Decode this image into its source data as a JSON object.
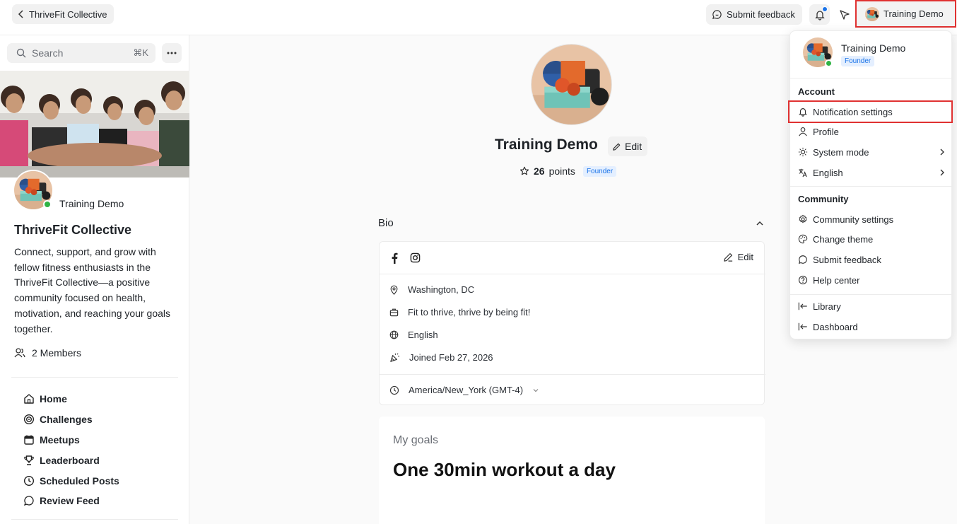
{
  "topbar": {
    "back_label": "ThriveFit Collective",
    "feedback_label": "Submit feedback",
    "user_label": "Training Demo"
  },
  "sidebar": {
    "search_placeholder": "Search",
    "search_shortcut": "⌘K",
    "username": "Training Demo",
    "community_title": "ThriveFit Collective",
    "description": "Connect, support, and grow with fellow fitness enthusiasts in the ThriveFit Collective—a positive community focused on health, motivation, and reaching your goals together.",
    "members": "2 Members",
    "nav": [
      {
        "label": "Home",
        "icon": "home-icon"
      },
      {
        "label": "Challenges",
        "icon": "target-icon"
      },
      {
        "label": "Meetups",
        "icon": "calendar-icon"
      },
      {
        "label": "Leaderboard",
        "icon": "trophy-icon"
      },
      {
        "label": "Scheduled Posts",
        "icon": "clock-icon"
      },
      {
        "label": "Review Feed",
        "icon": "chat-icon"
      }
    ]
  },
  "profile": {
    "name": "Training Demo",
    "edit_label": "Edit",
    "points_value": "26",
    "points_label": "points",
    "role_badge": "Founder"
  },
  "bio": {
    "label": "Bio",
    "edit_label": "Edit",
    "location": "Washington, DC",
    "tagline": "Fit to thrive, thrive by being fit!",
    "language": "English",
    "joined": "Joined Feb 27, 2026",
    "timezone": "America/New_York (GMT-4)"
  },
  "goals": {
    "label": "My goals",
    "text": "One 30min workout a day"
  },
  "menu": {
    "name": "Training Demo",
    "badge": "Founder",
    "account_heading": "Account",
    "account_items": [
      {
        "label": "Notification settings",
        "icon": "bell-icon"
      },
      {
        "label": "Profile",
        "icon": "user-icon"
      },
      {
        "label": "System mode",
        "icon": "sun-icon"
      },
      {
        "label": "English",
        "icon": "translate-icon"
      }
    ],
    "community_heading": "Community",
    "community_items": [
      {
        "label": "Community settings",
        "icon": "gear-icon"
      },
      {
        "label": "Change theme",
        "icon": "palette-icon"
      },
      {
        "label": "Submit feedback",
        "icon": "chat-icon"
      },
      {
        "label": "Help center",
        "icon": "help-icon"
      }
    ],
    "link_items": [
      {
        "label": "Library",
        "icon": "exit-arrow-icon"
      },
      {
        "label": "Dashboard",
        "icon": "exit-arrow-icon"
      }
    ]
  },
  "colors": {
    "accent": "#1a73e8",
    "highlight": "#e03131",
    "online": "#2fb344"
  }
}
